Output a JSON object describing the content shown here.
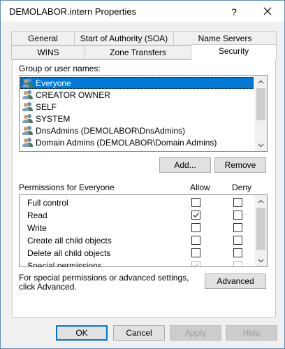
{
  "window": {
    "title": "DEMOLABOR.intern Properties",
    "help_label": "?"
  },
  "tabs": {
    "row_back": [
      "General",
      "Start of Authority (SOA)",
      "Name Servers"
    ],
    "row_front": [
      "WINS",
      "Zone Transfers",
      "Security"
    ],
    "active": "Security"
  },
  "security": {
    "group_label": "Group or user names:",
    "users": [
      "Everyone",
      "CREATOR OWNER",
      "SELF",
      "SYSTEM",
      "DnsAdmins (DEMOLABOR\\DnsAdmins)",
      "Domain Admins (DEMOLABOR\\Domain Admins)"
    ],
    "selected_user": "Everyone",
    "add_label": "Add...",
    "remove_label": "Remove",
    "permissions_label": "Permissions for Everyone",
    "allow_header": "Allow",
    "deny_header": "Deny",
    "permissions": [
      {
        "name": "Full control",
        "allow": false,
        "deny": false,
        "greyed": false
      },
      {
        "name": "Read",
        "allow": true,
        "deny": false,
        "greyed": false
      },
      {
        "name": "Write",
        "allow": false,
        "deny": false,
        "greyed": false
      },
      {
        "name": "Create all child objects",
        "allow": false,
        "deny": false,
        "greyed": false
      },
      {
        "name": "Delete all child objects",
        "allow": false,
        "deny": false,
        "greyed": false
      },
      {
        "name": "Special permissions",
        "allow": true,
        "deny": false,
        "greyed": true
      }
    ],
    "advanced_text": "For special permissions or advanced settings, click Advanced.",
    "advanced_label": "Advanced"
  },
  "buttons": {
    "ok": "OK",
    "cancel": "Cancel",
    "apply": "Apply",
    "help": "Help"
  },
  "colors": {
    "selection": "#0078d7",
    "window_border": "#5f8fbf"
  }
}
